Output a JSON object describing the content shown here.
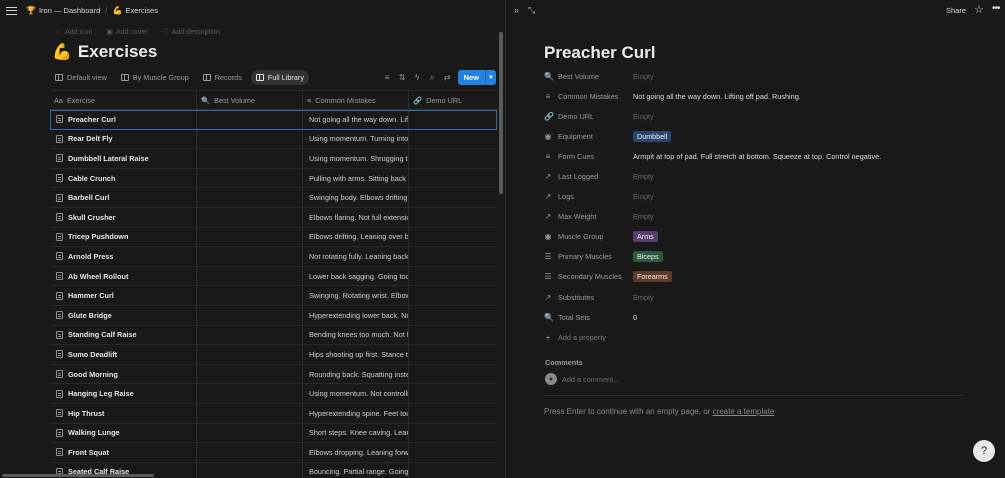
{
  "breadcrumb": [
    {
      "emoji": "🏆",
      "label": "Iron — Dashboard"
    },
    {
      "emoji": "💪",
      "label": "Exercises"
    }
  ],
  "page_meta": {
    "add_icon": "Add icon",
    "add_cover": "Add cover",
    "add_description": "Add description"
  },
  "page": {
    "emoji": "💪",
    "title": "Exercises"
  },
  "views": [
    {
      "label": "Default view",
      "active": false
    },
    {
      "label": "By Muscle Group",
      "active": false
    },
    {
      "label": "Records",
      "active": false
    },
    {
      "label": "Full Library",
      "active": true
    }
  ],
  "toolbar": {
    "new_label": "New",
    "icons": [
      "filter-icon",
      "sort-icon",
      "automation-icon",
      "search-icon",
      "settings-icon"
    ]
  },
  "table": {
    "columns": [
      {
        "icon": "Aa",
        "label": "Exercise"
      },
      {
        "icon": "🔍",
        "label": "Best Volume"
      },
      {
        "icon": "≡",
        "label": "Common Mistakes"
      },
      {
        "icon": "🔗",
        "label": "Demo URL"
      }
    ],
    "rows": [
      {
        "name": "Preacher Curl",
        "mistakes": "Not going all the way down. Lifting off pad. Rushing."
      },
      {
        "name": "Rear Delt Fly",
        "mistakes": "Using momentum. Turning into a row."
      },
      {
        "name": "Dumbbell Lateral Raise",
        "mistakes": "Using momentum. Shrugging traps."
      },
      {
        "name": "Cable Crunch",
        "mistakes": "Pulling with arms. Sitting back on heels."
      },
      {
        "name": "Barbell Curl",
        "mistakes": "Swinging body. Elbows drifting forward."
      },
      {
        "name": "Skull Crusher",
        "mistakes": "Elbows flaring. Not full extension."
      },
      {
        "name": "Tricep Pushdown",
        "mistakes": "Elbows drifting. Leaning over bar."
      },
      {
        "name": "Arnold Press",
        "mistakes": "Not rotating fully. Leaning back."
      },
      {
        "name": "Ab Wheel Rollout",
        "mistakes": "Lower back sagging. Going too far."
      },
      {
        "name": "Hammer Curl",
        "mistakes": "Swinging. Rotating wrist. Elbows moving."
      },
      {
        "name": "Glute Bridge",
        "mistakes": "Hyperextending lower back. Not squeezing."
      },
      {
        "name": "Standing Calf Raise",
        "mistakes": "Bending knees too much. Not full range."
      },
      {
        "name": "Sumo Deadlift",
        "mistakes": "Hips shooting up first. Stance too wide."
      },
      {
        "name": "Good Morning",
        "mistakes": "Rounding back. Squatting instead of hinging."
      },
      {
        "name": "Hanging Leg Raise",
        "mistakes": "Using momentum. Not controlling descent."
      },
      {
        "name": "Hip Thrust",
        "mistakes": "Hyperextending spine. Feet too far."
      },
      {
        "name": "Walking Lunge",
        "mistakes": "Short steps. Knee caving. Leaning forward."
      },
      {
        "name": "Front Squat",
        "mistakes": "Elbows dropping. Leaning forward."
      },
      {
        "name": "Seated Calf Raise",
        "mistakes": "Bouncing. Partial range. Going too fast."
      }
    ]
  },
  "detail": {
    "share_label": "Share",
    "title": "Preacher Curl",
    "properties": [
      {
        "icon": "🔍",
        "name": "Best Volume",
        "value": "Empty",
        "type": "empty"
      },
      {
        "icon": "≡",
        "name": "Common Mistakes",
        "value": "Not going all the way down. Lifting off pad. Rushing.",
        "type": "text"
      },
      {
        "icon": "🔗",
        "name": "Demo URL",
        "value": "Empty",
        "type": "empty"
      },
      {
        "icon": "◉",
        "name": "Equipment",
        "value": "Dumbbell",
        "type": "tag",
        "color": "#28456c"
      },
      {
        "icon": "≡",
        "name": "Form Cues",
        "value": "Armpit at top of pad. Full stretch at bottom. Squeeze at top. Control negative.",
        "type": "text"
      },
      {
        "icon": "↗",
        "name": "Last Logged",
        "value": "Empty",
        "type": "empty"
      },
      {
        "icon": "↗",
        "name": "Logs",
        "value": "Empty",
        "type": "empty"
      },
      {
        "icon": "↗",
        "name": "Max Weight",
        "value": "Empty",
        "type": "empty"
      },
      {
        "icon": "◉",
        "name": "Muscle Group",
        "value": "Arms",
        "type": "tag",
        "color": "#5a3b6e"
      },
      {
        "icon": "☰",
        "name": "Primary Muscles",
        "value": "Biceps",
        "type": "tag",
        "color": "#2b593f"
      },
      {
        "icon": "☰",
        "name": "Secondary Muscles",
        "value": "Forearms",
        "type": "tag",
        "color": "#603b2c"
      },
      {
        "icon": "↗",
        "name": "Substitutes",
        "value": "Empty",
        "type": "empty"
      },
      {
        "icon": "🔍",
        "name": "Total Sets",
        "value": "0",
        "type": "text"
      }
    ],
    "add_property": "Add a property",
    "comments_label": "Comments",
    "comment_placeholder": "Add a comment...",
    "hint_text": "Press Enter to continue with an empty page, or ",
    "hint_link": "create a template"
  },
  "colors": {
    "accent": "#2383e2",
    "background": "#191919"
  }
}
